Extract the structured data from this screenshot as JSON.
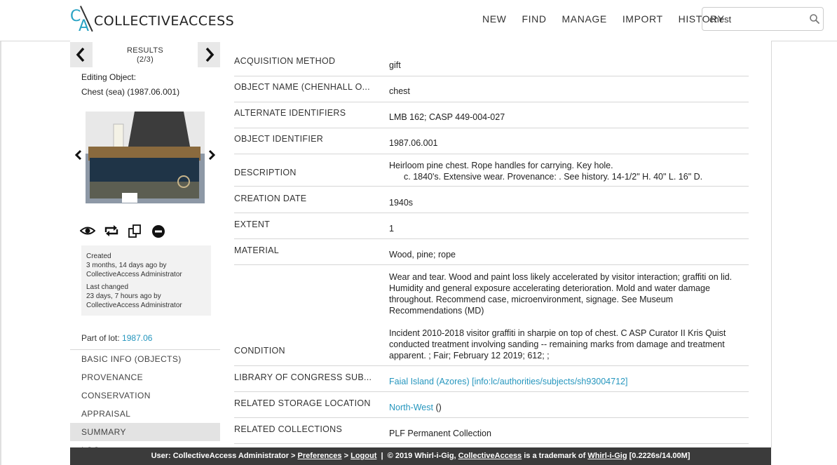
{
  "app": {
    "brand": "COLLECTIVEACCESS",
    "logo_letters": "CA"
  },
  "nav": {
    "new": "NEW",
    "find": "FIND",
    "manage": "MANAGE",
    "import": "IMPORT",
    "history": "HISTORY"
  },
  "search": {
    "value": "chest"
  },
  "sidebar": {
    "results_label": "RESULTS",
    "results_count": "(2/3)",
    "editing_label": "Editing Object:",
    "object_name": "Chest (sea) (1987.06.001)",
    "created_label": "Created",
    "created_when": "3 months, 14 days ago by",
    "created_by": "CollectiveAccess Administrator",
    "changed_label": "Last changed",
    "changed_when": "23 days, 7 hours ago by",
    "changed_by": "CollectiveAccess Administrator",
    "lot_label": "Part of lot:",
    "lot_value": "1987.06",
    "items": [
      {
        "label": "BASIC INFO (OBJECTS)"
      },
      {
        "label": "PROVENANCE"
      },
      {
        "label": "CONSERVATION"
      },
      {
        "label": "APPRAISAL"
      },
      {
        "label": "SUMMARY"
      },
      {
        "label": "LOG"
      }
    ]
  },
  "fields": [
    {
      "label": "ACQUISITION METHOD",
      "value": "gift"
    },
    {
      "label": "OBJECT NAME (CHENHALL O...",
      "value": "chest"
    },
    {
      "label": "ALTERNATE IDENTIFIERS",
      "value": "LMB 162; CASP 449-004-027"
    },
    {
      "label": "OBJECT IDENTIFIER",
      "value": "1987.06.001"
    },
    {
      "label": "DESCRIPTION",
      "value_line1": "Heirloom pine chest. Rope handles for carrying. Key hole.",
      "value_line2": "c. 1840's. Extensive wear. Provenance: . See history. 14-1/2\" H. 40\" L. 16\" D."
    },
    {
      "label": "CREATION DATE",
      "value": "1940s"
    },
    {
      "label": "EXTENT",
      "value": "1"
    },
    {
      "label": "MATERIAL",
      "value": "Wood, pine; rope"
    },
    {
      "label": "CONDITION",
      "value_p1": "Wear and tear. Wood and paint loss likely accelerated by visitor interaction; graffiti on lid. Humidity and general exposure accelerating deterioration. Mold and water damage throughout. Recommend case, microenvironment, signage. See Museum Recommendations (MD)",
      "value_p2": "Incident 2010-2018 visitor graffiti in sharpie on top of chest. C ASP Curator II Kris Quist conducted treatment involving sanding -- remaining marks from damage and treatment apparent. ; Fair; February 12 2019; 612; ;"
    },
    {
      "label": "LIBRARY OF CONGRESS SUB...",
      "value": "Faial Island (Azores) [info:lc/authorities/subjects/sh93004712]"
    },
    {
      "label": "RELATED STORAGE LOCATIONS",
      "value_link": "North-West",
      "value_suffix": " ()"
    },
    {
      "label": "RELATED COLLECTIONS",
      "value": "PLF Permanent Collection"
    }
  ],
  "footer": {
    "user": "User: CollectiveAccess Administrator > ",
    "preferences": "Preferences",
    "sep1": " > ",
    "logout": "Logout",
    "sep2": "  |  © 2019 Whirl-i-Gig, ",
    "ca": "CollectiveAccess",
    "mid": " is a trademark of ",
    "wig": "Whirl-i-Gig",
    "timing": " [0.2226s/14.00M]"
  },
  "colors": {
    "accent": "#2596be",
    "logo": "#29a3c4",
    "footer_bg": "#3b3b3b"
  }
}
